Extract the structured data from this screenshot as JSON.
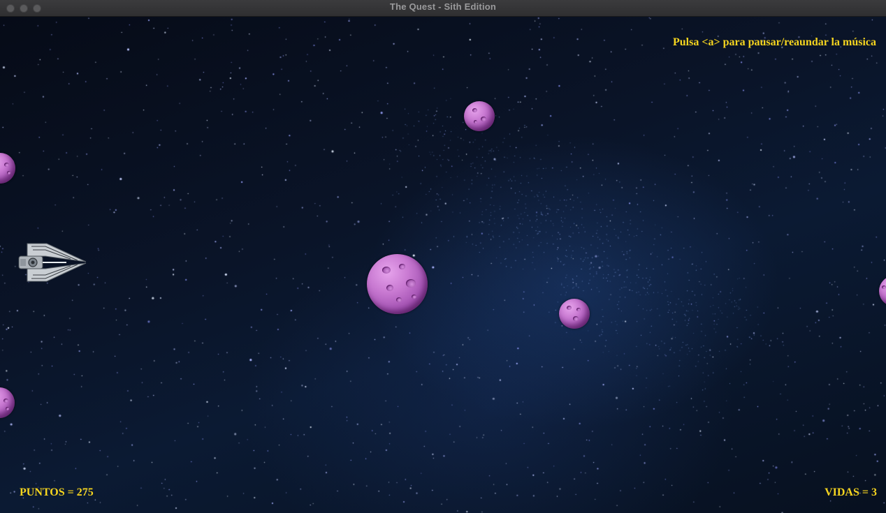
{
  "window": {
    "title": "The Quest - Sith Edition"
  },
  "hud": {
    "music_hint": "Pulsa <a> para pausar/reaundar la música",
    "score_text": "PUNTOS = 275",
    "lives_text": "VIDAS = 3",
    "color": "#f6d51f"
  },
  "game": {
    "score": 275,
    "lives": 3,
    "player": {
      "sprite": "sith-interceptor-ship-icon"
    },
    "asteroids": [
      {
        "id": "asteroid-1",
        "sprite": "purple-asteroid-icon"
      },
      {
        "id": "asteroid-2",
        "sprite": "purple-asteroid-icon"
      },
      {
        "id": "asteroid-3",
        "sprite": "purple-asteroid-icon"
      },
      {
        "id": "asteroid-4",
        "sprite": "purple-asteroid-icon"
      },
      {
        "id": "asteroid-5",
        "sprite": "purple-asteroid-icon"
      },
      {
        "id": "asteroid-6",
        "sprite": "purple-asteroid-icon"
      }
    ]
  },
  "colors": {
    "asteroid": "#c97ad2",
    "background": "#0a1428"
  }
}
